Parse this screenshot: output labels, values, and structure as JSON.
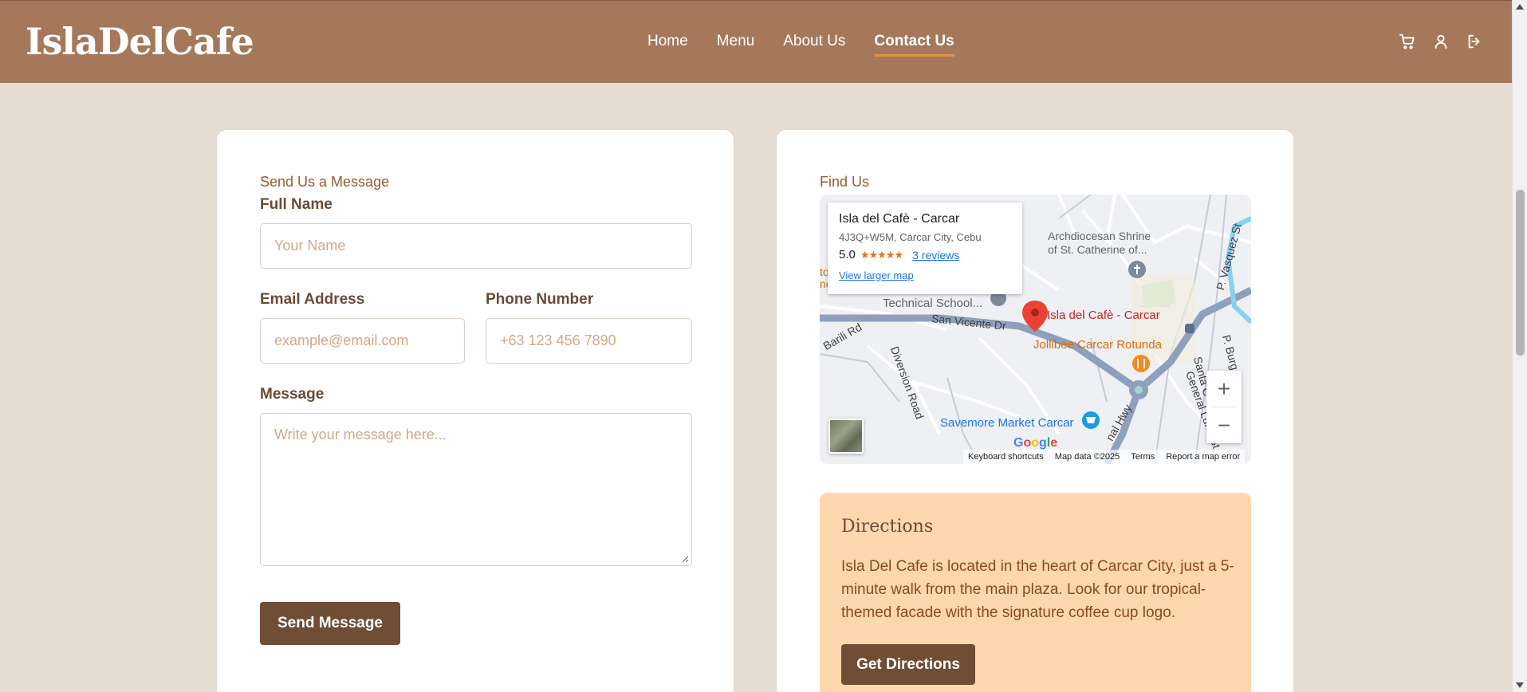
{
  "header": {
    "logo": "IslaDelCafe",
    "nav": [
      {
        "label": "Home",
        "active": false
      },
      {
        "label": "Menu",
        "active": false
      },
      {
        "label": "About Us",
        "active": false
      },
      {
        "label": "Contact Us",
        "active": true
      }
    ],
    "icons": [
      "cart-icon",
      "user-icon",
      "logout-icon"
    ]
  },
  "contact_form": {
    "title": "Send Us a Message",
    "full_name": {
      "label": "Full Name",
      "placeholder": "Your Name",
      "value": ""
    },
    "email": {
      "label": "Email Address",
      "placeholder": "example@email.com",
      "value": ""
    },
    "phone": {
      "label": "Phone Number",
      "placeholder": "+63 123 456 7890",
      "value": ""
    },
    "message": {
      "label": "Message",
      "placeholder": "Write your message here...",
      "value": ""
    },
    "submit_label": "Send Message"
  },
  "find_us": {
    "title": "Find Us",
    "map": {
      "place_name": "Isla del Cafè - Carcar",
      "address": "4J3Q+W5M, Carcar City, Cebu",
      "rating": "5.0",
      "stars": "★★★★★",
      "reviews": "3 reviews",
      "view_larger": "View larger map",
      "labels": {
        "shrine": "Archdiocesan Shrine\nof St. Catherine of...",
        "tech_school": "Technical School...",
        "san_vicente": "San Vicente Dr",
        "barili": "Barili Rd",
        "diversion": "Diversion Road",
        "marker_label": "Isla del Cafè - Carcar",
        "jollibee": "Jollibee Carcar Rotunda",
        "savemore": "Savemore Market Carcar",
        "highway": "nal Hwy",
        "general_luna": "General Luna St",
        "santa": "Santa C",
        "p_vasquez": "P. Vasquez St",
        "p_burg": "P. Burg",
        "edge_to": "to",
        "edge_ne": "ne"
      },
      "google": "Google",
      "footer": [
        "Keyboard shortcuts",
        "Map data ©2025",
        "Terms",
        "Report a map error"
      ],
      "zoom_in": "+",
      "zoom_out": "−"
    },
    "directions": {
      "title": "Directions",
      "text": "Isla Del Cafe is located in the heart of Carcar City, just a 5-minute walk from the main plaza. Look for our tropical-themed facade with the signature coffee cup logo.",
      "button_label": "Get Directions"
    }
  },
  "colors": {
    "header_bg": "#a5785b",
    "page_bg": "#e6dcd2",
    "button_bg": "#704d35",
    "accent_underline": "#e2933f",
    "directions_bg": "#ffd7af"
  }
}
